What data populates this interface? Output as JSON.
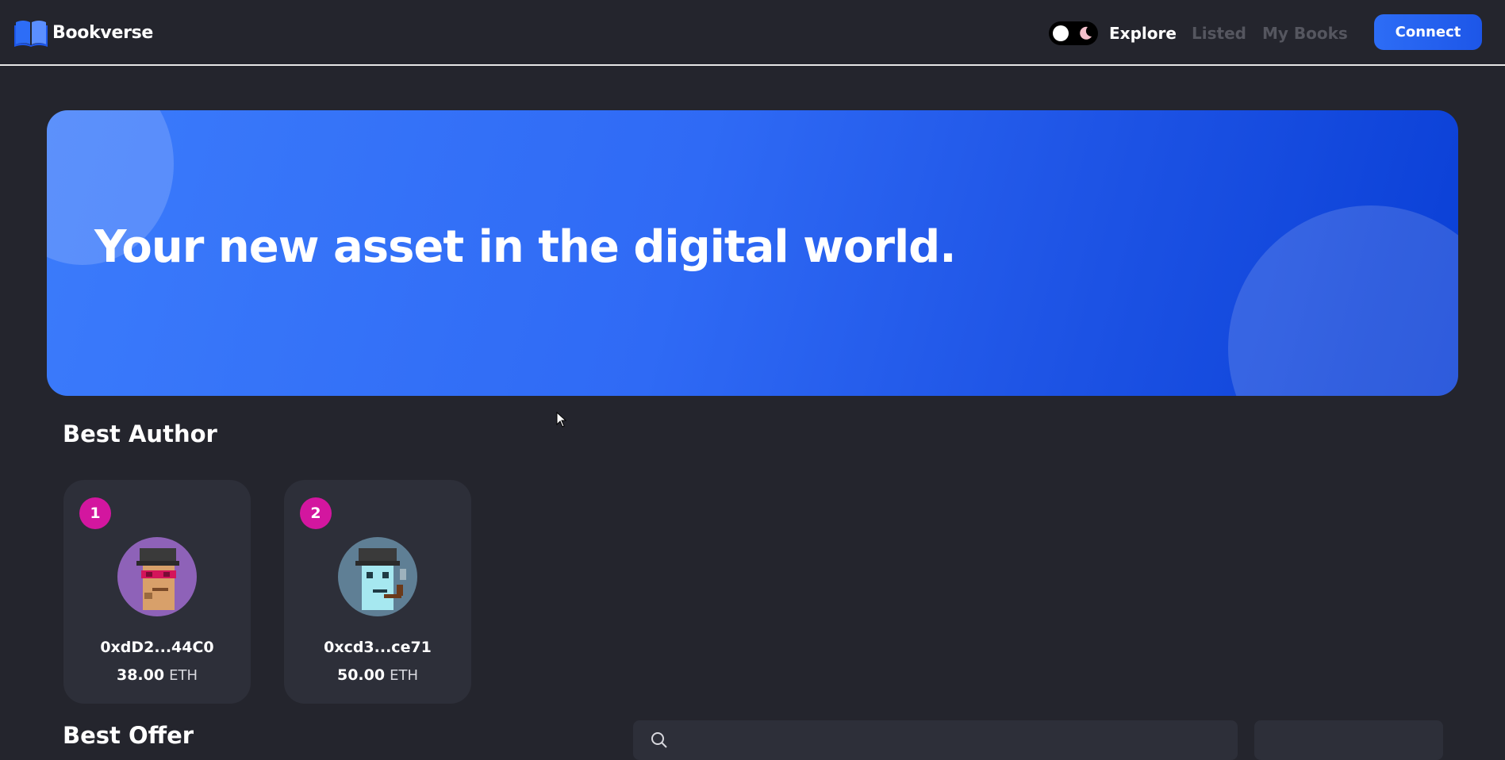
{
  "app": {
    "name": "Bookverse"
  },
  "nav": {
    "links": [
      {
        "label": "Explore",
        "active": true
      },
      {
        "label": "Listed",
        "active": false
      },
      {
        "label": "My Books",
        "active": false
      }
    ],
    "connect_label": "Connect",
    "theme_toggle": {
      "icons": [
        "sun-knob",
        "moon-icon"
      ]
    }
  },
  "hero": {
    "title": "Your new asset in the digital world."
  },
  "best_author": {
    "title": "Best Author",
    "authors": [
      {
        "rank": "1",
        "address": "0xdD2...44C0",
        "amount": "38.00",
        "unit": "ETH",
        "avatar_bg": "#8e62b8"
      },
      {
        "rank": "2",
        "address": "0xcd3...ce71",
        "amount": "50.00",
        "unit": "ETH",
        "avatar_bg": "#5f7f95"
      }
    ]
  },
  "best_offer": {
    "title": "Best Offer"
  },
  "colors": {
    "background": "#24252d",
    "card": "#2d2f39",
    "accent": "#2d6df6",
    "badge": "#d3169f"
  }
}
